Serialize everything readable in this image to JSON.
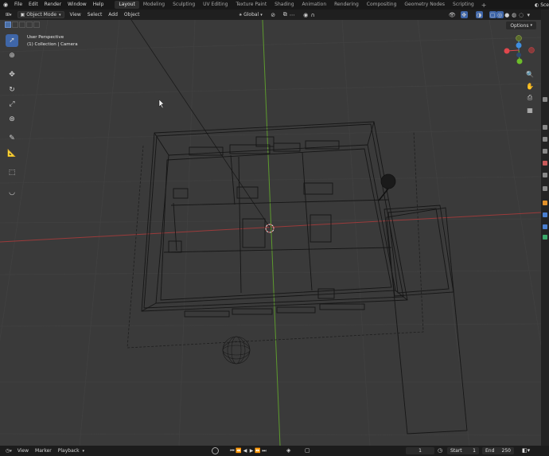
{
  "menu": {
    "items": [
      "File",
      "Edit",
      "Render",
      "Window",
      "Help"
    ]
  },
  "workspaces": [
    "Layout",
    "Modeling",
    "Sculpting",
    "UV Editing",
    "Texture Paint",
    "Shading",
    "Animation",
    "Rendering",
    "Compositing",
    "Geometry Nodes",
    "Scripting"
  ],
  "workspace_add": "+",
  "scene_label": "Sce",
  "header": {
    "mode": "Object Mode",
    "menus": [
      "View",
      "Select",
      "Add",
      "Object"
    ],
    "orientation": "Global"
  },
  "options_label": "Options",
  "viewport_overlay": {
    "line1": "User Perspective",
    "line2": "(1) Collection | Camera"
  },
  "gizmo": {
    "x_color": "#e0474c",
    "y_color": "#6cbd2a",
    "z_color": "#3f8fe0"
  },
  "timeline": {
    "menus": [
      "View",
      "Marker",
      "Playback"
    ],
    "current_frame": "1",
    "start_label": "Start",
    "start_value": "1",
    "end_label": "End",
    "end_value": "250"
  },
  "colors": {
    "accent": "#3f66a8",
    "x_axis": "#9b3b3b",
    "y_axis": "#5d9a2e"
  }
}
